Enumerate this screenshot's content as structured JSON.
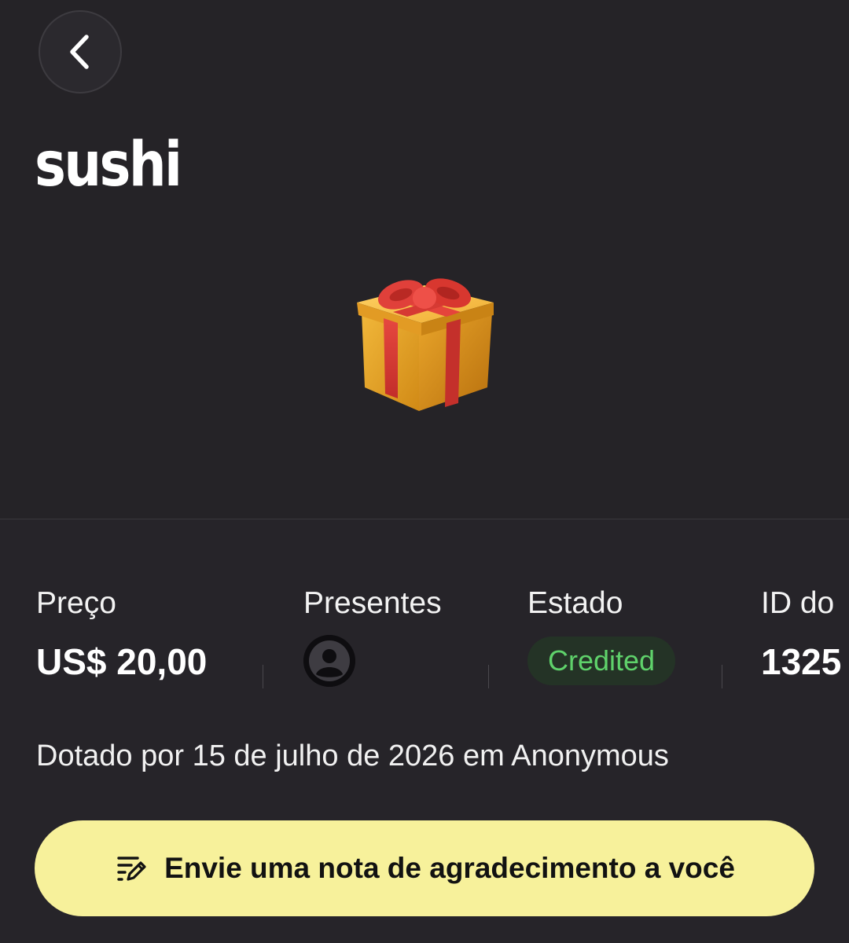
{
  "header": {
    "back_icon": "chevron-left-icon",
    "title": "sushi"
  },
  "hero": {
    "image_icon": "gift-box-icon"
  },
  "stats": {
    "price_label": "Preço",
    "price_value": "US$ 20,00",
    "gifts_label": "Presentes",
    "gifts_avatar_icon": "anonymous-user-icon",
    "status_label": "Estado",
    "status_value": "Credited",
    "id_label": "ID do",
    "id_value": "1325"
  },
  "gifted_line": "Dotado por 15 de julho de 2026 em Anonymous",
  "action_button": {
    "icon": "write-note-icon",
    "label": "Envie uma nota de agradecimento a você"
  },
  "colors": {
    "background": "#262429",
    "button_bg": "#f7f19b",
    "status_text": "#5fd26b",
    "status_bg": "#243326"
  }
}
